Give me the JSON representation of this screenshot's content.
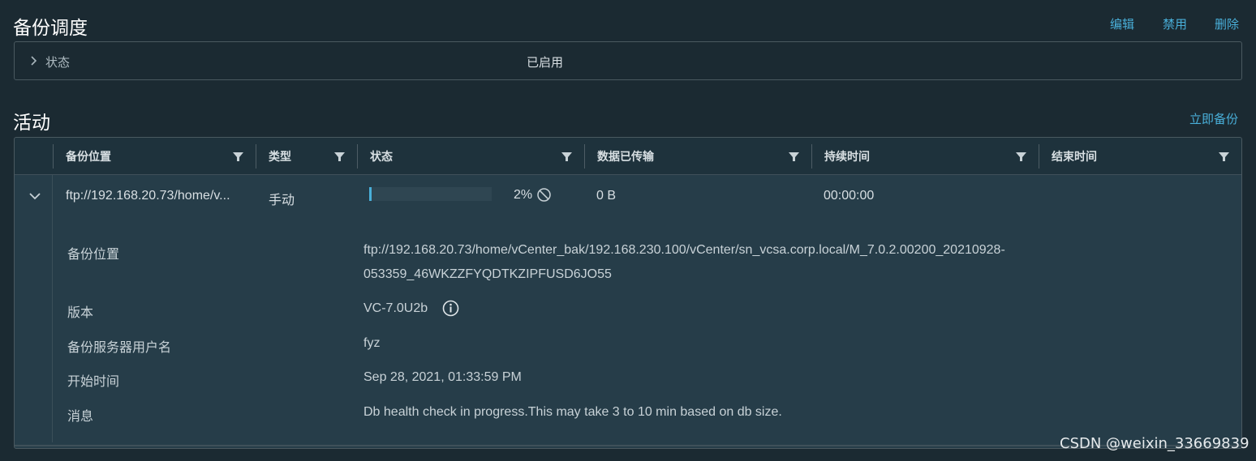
{
  "schedule": {
    "title": "备份调度",
    "actions": {
      "edit": "编辑",
      "disable": "禁用",
      "delete": "删除"
    },
    "status_label": "状态",
    "status_value": "已启用"
  },
  "activity": {
    "title": "活动",
    "backup_now": "立即备份",
    "columns": [
      "备份位置",
      "类型",
      "状态",
      "数据已传输",
      "持续时间",
      "结束时间"
    ],
    "row": {
      "location": "ftp://192.168.20.73/home/v...",
      "type": "手动",
      "progress_percent": 2,
      "progress_text": "2%",
      "transferred": "0 B",
      "duration": "00:00:00",
      "end_time": ""
    },
    "details": {
      "location_label": "备份位置",
      "location_line1": "ftp://192.168.20.73/home/vCenter_bak/192.168.230.100/vCenter/sn_vcsa.corp.local/M_7.0.2.00200_20210928-",
      "location_line2": "053359_46WKZZFYQDTKZIPFUSD6JO55",
      "version_label": "版本",
      "version_value": "VC-7.0U2b",
      "user_label": "备份服务器用户名",
      "user_value": "fyz",
      "start_label": "开始时间",
      "start_value": "Sep 28, 2021, 01:33:59 PM",
      "message_label": "消息",
      "message_value": "Db health check in progress.This may take 3 to 10 min based on db size."
    }
  },
  "watermark": "CSDN @weixin_33669839",
  "colors": {
    "accent": "#49afd9",
    "background": "#1b2a32",
    "row_bg": "#263d49"
  }
}
